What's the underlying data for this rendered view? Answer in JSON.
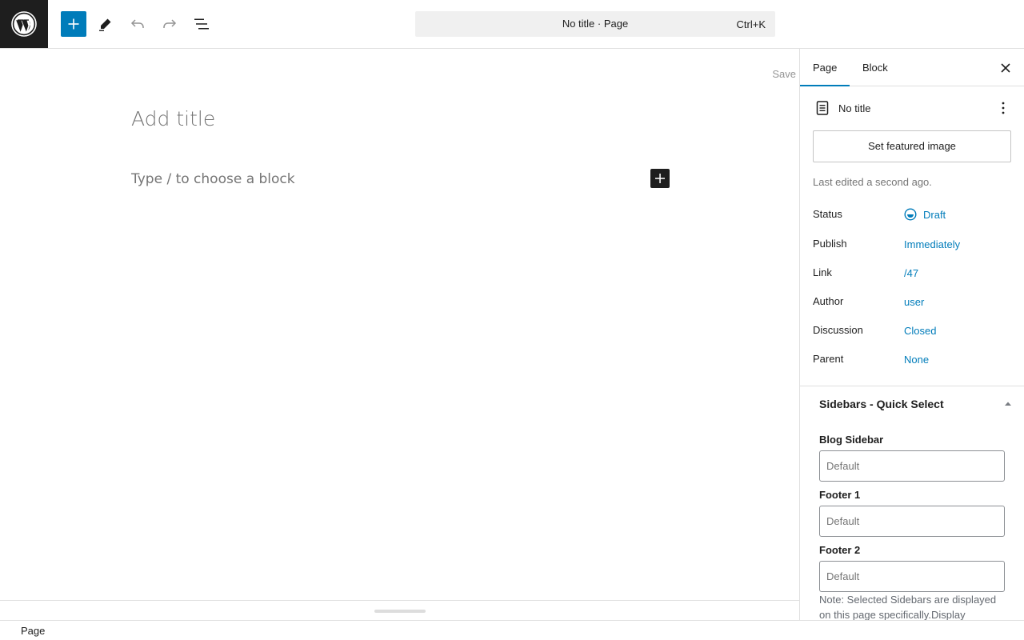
{
  "header": {
    "command_title": "No title · Page",
    "command_shortcut": "Ctrl+K"
  },
  "editor": {
    "save_label": "Save",
    "title_placeholder": "Add title",
    "block_placeholder": "Type / to choose a block"
  },
  "statusbar": {
    "breadcrumb": "Page"
  },
  "sidebar": {
    "tabs": [
      {
        "label": "Page",
        "active": true
      },
      {
        "label": "Block",
        "active": false
      }
    ],
    "post_title": "No title",
    "featured_image_label": "Set featured image",
    "last_edited": "Last edited a second ago.",
    "meta": [
      {
        "label": "Status",
        "value": "Draft"
      },
      {
        "label": "Publish",
        "value": "Immediately"
      },
      {
        "label": "Link",
        "value": "/47"
      },
      {
        "label": "Author",
        "value": "user"
      },
      {
        "label": "Discussion",
        "value": "Closed"
      },
      {
        "label": "Parent",
        "value": "None"
      }
    ],
    "sidebars_panel": {
      "title": "Sidebars - Quick Select",
      "fields": [
        {
          "label": "Blog Sidebar",
          "value": "Default"
        },
        {
          "label": "Footer 1",
          "value": "Default"
        },
        {
          "label": "Footer 2",
          "value": "Default"
        }
      ],
      "note": "Note: Selected Sidebars are displayed on this page specifically.Display"
    }
  },
  "colors": {
    "accent": "#007cba",
    "dark": "#1e1e1e"
  },
  "icons": [
    "wordpress-logo-icon",
    "plus-icon",
    "pencil-icon",
    "undo-icon",
    "redo-icon",
    "list-view-icon",
    "close-icon",
    "page-icon",
    "more-vertical-icon",
    "draft-status-icon",
    "caret-up-icon"
  ]
}
